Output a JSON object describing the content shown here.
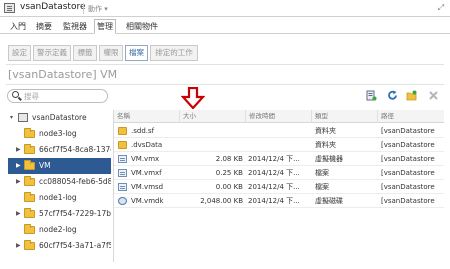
{
  "header": {
    "title": "vsanDatastore",
    "actions_label": "動作 ▾"
  },
  "tabs": [
    {
      "label": "入門"
    },
    {
      "label": "摘要"
    },
    {
      "label": "監視器"
    },
    {
      "label": "管理"
    },
    {
      "label": "相關物件"
    }
  ],
  "subtabs": [
    {
      "label": "設定"
    },
    {
      "label": "警示定義"
    },
    {
      "label": "標籤"
    },
    {
      "label": "權限"
    },
    {
      "label": "檔案"
    },
    {
      "label": "排定的工作"
    }
  ],
  "page_title": "[vsanDatastore] VM",
  "search": {
    "placeholder": "搜尋"
  },
  "tree": [
    {
      "label": "vsanDatastore",
      "expanded": true
    },
    {
      "label": "node3-log"
    },
    {
      "label": "66cf7f54-8ca8-137c"
    },
    {
      "label": "VM",
      "selected": true
    },
    {
      "label": "cc088054-feb6-5d8a"
    },
    {
      "label": "node1-log"
    },
    {
      "label": "57cf7f54-7229-17b"
    },
    {
      "label": "node2-log"
    },
    {
      "label": "60cf7f54-3a71-a7f5"
    }
  ],
  "table": {
    "columns": [
      "名稱",
      "大小",
      "修改時間",
      "類型",
      "路徑"
    ],
    "rows": [
      {
        "icon": "folder-icon",
        "name": ".sdd.sf",
        "size": "",
        "modified": "",
        "type": "資料夾",
        "path": "[vsanDatastore"
      },
      {
        "icon": "folder-icon",
        "name": ".dvsData",
        "size": "",
        "modified": "",
        "type": "資料夾",
        "path": "[vsanDatastore"
      },
      {
        "icon": "file-icon",
        "name": "VM.vmx",
        "size": "2.08 KB",
        "modified": "2014/12/4 下...",
        "type": "虛擬機器",
        "path": "[vsanDatastore"
      },
      {
        "icon": "file-icon",
        "name": "VM.vmxf",
        "size": "0.25 KB",
        "modified": "2014/12/4 下...",
        "type": "檔案",
        "path": "[vsanDatastore"
      },
      {
        "icon": "file-icon",
        "name": "VM.vmsd",
        "size": "0.00 KB",
        "modified": "2014/12/4 下...",
        "type": "檔案",
        "path": "[vsanDatastore"
      },
      {
        "icon": "disk-icon",
        "name": "VM.vmdk",
        "size": "2,048.00 KB",
        "modified": "2014/12/4 下...",
        "type": "虛擬磁碟",
        "path": "[vsanDatastore"
      }
    ]
  },
  "colors": {
    "accent": "#2d5a93",
    "arrow": "#cc0000",
    "folder": "#f0c040"
  }
}
